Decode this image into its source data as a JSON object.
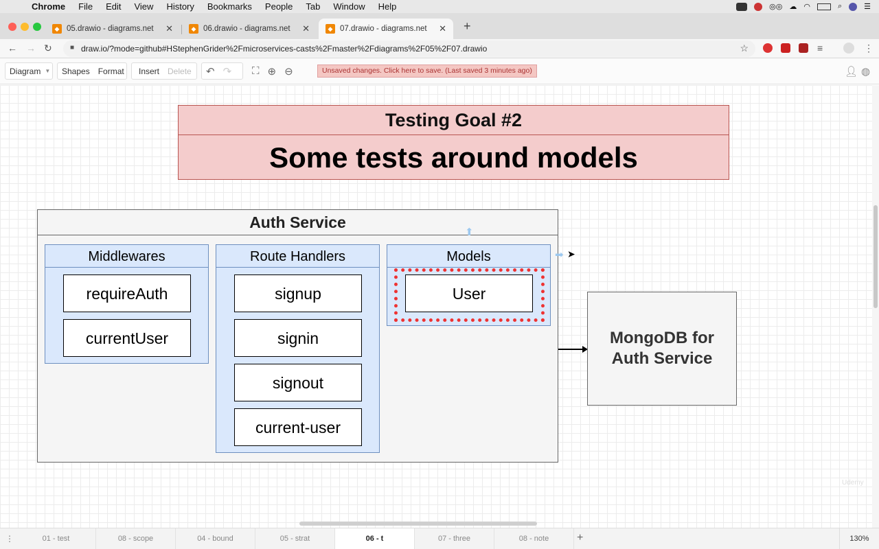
{
  "menubar": {
    "app": "Chrome",
    "items": [
      "File",
      "Edit",
      "View",
      "History",
      "Bookmarks",
      "People",
      "Tab",
      "Window",
      "Help"
    ]
  },
  "tabs": [
    {
      "title": "05.drawio - diagrams.net"
    },
    {
      "title": "06.drawio - diagrams.net"
    },
    {
      "title": "07.drawio - diagrams.net"
    }
  ],
  "address": {
    "url": "draw.io/?mode=github#HStephenGrider%2Fmicroservices-casts%2Fmaster%2Fdiagrams%2F05%2F07.drawio"
  },
  "toolbar": {
    "diagram": "Diagram",
    "shapes": "Shapes",
    "format": "Format",
    "insert": "Insert",
    "delete": "Delete",
    "unsaved": "Unsaved changes. Click here to save. (Last saved 3 minutes ago)"
  },
  "diagram": {
    "goal_title": "Testing Goal #2",
    "goal_subtitle": "Some tests around models",
    "service_title": "Auth Service",
    "lanes": [
      {
        "title": "Middlewares",
        "items": [
          "requireAuth",
          "currentUser"
        ]
      },
      {
        "title": "Route Handlers",
        "items": [
          "signup",
          "signin",
          "signout",
          "current-user"
        ]
      },
      {
        "title": "Models",
        "items": [
          "User"
        ]
      }
    ],
    "database": {
      "line1": "MongoDB for",
      "line2": "Auth Service"
    },
    "watermark": "Udemy"
  },
  "pages": {
    "tabs": [
      "01 - test",
      "08 - scope",
      "04 - bound",
      "05 - strat",
      "06 - t",
      "07 - three",
      "08 - note"
    ],
    "active": "06 - t",
    "zoom": "130%"
  },
  "colors": {
    "goal_fill": "#f4cccc",
    "lane_fill": "#dae8fc",
    "highlight": "#ee3333",
    "drawio_orange": "#f08705"
  }
}
